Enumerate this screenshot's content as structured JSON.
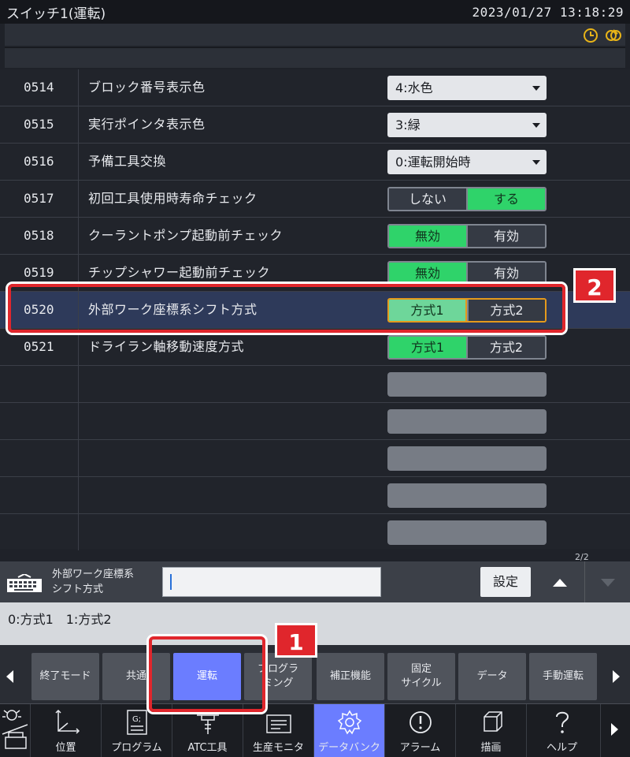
{
  "titlebar": {
    "title": "スイッチ1(運転)",
    "datetime": "2023/01/27 13:18:29"
  },
  "status_icons": [
    "clock-icon",
    "link-icon"
  ],
  "rows": [
    {
      "num": "0514",
      "label": "ブロック番号表示色",
      "type": "dropdown",
      "value": "4:水色"
    },
    {
      "num": "0515",
      "label": "実行ポインタ表示色",
      "type": "dropdown",
      "value": "3:緑"
    },
    {
      "num": "0516",
      "label": "予備工具交換",
      "type": "dropdown",
      "value": "0:運転開始時"
    },
    {
      "num": "0517",
      "label": "初回工具使用時寿命チェック",
      "type": "toggle",
      "options": [
        "しない",
        "する"
      ],
      "selected": 1
    },
    {
      "num": "0518",
      "label": "クーラントポンプ起動前チェック",
      "type": "toggle",
      "options": [
        "無効",
        "有効"
      ],
      "selected": 0
    },
    {
      "num": "0519",
      "label": "チップシャワー起動前チェック",
      "type": "toggle",
      "options": [
        "無効",
        "有効"
      ],
      "selected": 0
    },
    {
      "num": "0520",
      "label": "外部ワーク座標系シフト方式",
      "type": "toggle",
      "options": [
        "方式1",
        "方式2"
      ],
      "selected": 0,
      "focused": true
    },
    {
      "num": "0521",
      "label": "ドライラン軸移動速度方式",
      "type": "toggle",
      "options": [
        "方式1",
        "方式2"
      ],
      "selected": 0
    }
  ],
  "input": {
    "label_line1": "外部ワーク座標系",
    "label_line2": "シフト方式",
    "value": "",
    "set_label": "設定",
    "page": "2/2"
  },
  "hint": "0:方式1　1:方式2",
  "softkeys": [
    {
      "line1": "終了モード",
      "line2": ""
    },
    {
      "line1": "共通",
      "line2": ""
    },
    {
      "line1": "運転",
      "line2": "",
      "active": true
    },
    {
      "line1": "プログラ",
      "line2": "ミング"
    },
    {
      "line1": "補正機能",
      "line2": ""
    },
    {
      "line1": "固定",
      "line2": "サイクル"
    },
    {
      "line1": "データ",
      "line2": ""
    },
    {
      "line1": "手動運転",
      "line2": ""
    }
  ],
  "nav": [
    {
      "label": "位置",
      "icon": "axes-icon"
    },
    {
      "label": "プログラム",
      "icon": "program-icon"
    },
    {
      "label": "ATC工具",
      "icon": "tool-icon"
    },
    {
      "label": "生産モニタ",
      "icon": "monitor-icon"
    },
    {
      "label": "データバンク",
      "icon": "gear-icon",
      "active": true
    },
    {
      "label": "アラーム",
      "icon": "alarm-icon"
    },
    {
      "label": "描画",
      "icon": "cube-icon"
    },
    {
      "label": "ヘルプ",
      "icon": "help-icon"
    }
  ],
  "annotations": [
    "1",
    "2"
  ],
  "colors": {
    "accent": "#6b7dff",
    "toggle_on": "#2fd36a",
    "callout": "#e0262c",
    "focus": "#e59a1c"
  }
}
